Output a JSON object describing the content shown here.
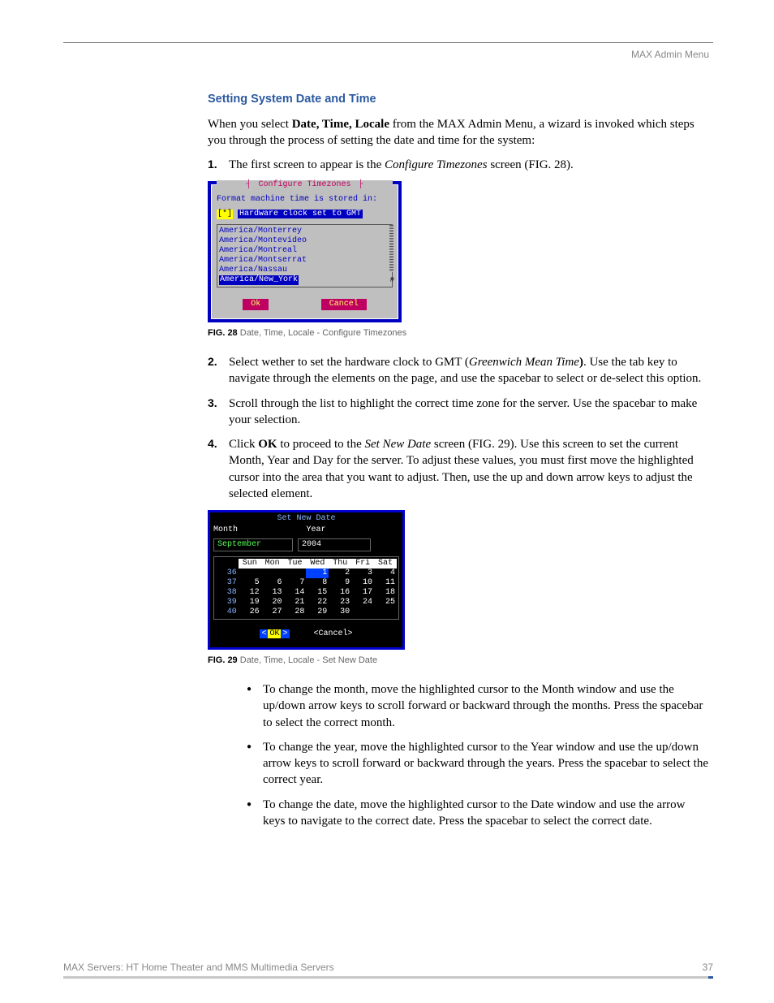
{
  "header": {
    "section": "MAX Admin Menu"
  },
  "title": "Setting System Date and Time",
  "intro": {
    "pre": "When you select ",
    "bold": "Date, Time, Locale",
    "post": " from the MAX Admin Menu, a wizard is invoked which steps you through the process of setting the date and time for the system:"
  },
  "steps": {
    "s1": {
      "num": "1.",
      "pre": "The first screen to appear is the ",
      "ital": "Configure Timezones",
      "post": " screen (FIG. 28)."
    },
    "s2": {
      "num": "2.",
      "pre": "Select wether to set the hardware clock to GMT (",
      "ital": "Greenwich Mean Time",
      "mid": "",
      "bold": ")",
      "post": ". Use the tab key to navigate through the elements on the page, and use the spacebar to select or de-select this option."
    },
    "s3": {
      "num": "3.",
      "text": "Scroll through the list to highlight the correct time zone for the server. Use the spacebar to make your selection."
    },
    "s4": {
      "num": "4.",
      "pre": "Click ",
      "bold": "OK",
      "mid": " to proceed to the ",
      "ital": "Set New Date",
      "post": " screen (FIG. 29). Use this screen to set the current Month, Year and Day for the server. To adjust these values, you must first move the highlighted cursor into the area that you want to adjust. Then, use the up and down arrow keys to adjust the selected element."
    }
  },
  "fig28": {
    "title": "Configure Timezones",
    "prompt": "Format machine time is stored in:",
    "checkbox_mark": "[*]",
    "checkbox_label": "Hardware clock set to GMT",
    "tz": {
      "a": "America/Monterrey",
      "b": "America/Montevideo",
      "c": "America/Montreal",
      "d": "America/Montserrat",
      "e": "America/Nassau",
      "f": "America/New_York"
    },
    "ok": "Ok",
    "cancel": "Cancel",
    "caption_tag": "FIG. 28",
    "caption": "  Date, Time, Locale - Configure Timezones"
  },
  "fig29": {
    "title": "Set New Date",
    "month_label": "Month",
    "year_label": "Year",
    "month_value": "September",
    "year_value": "2004",
    "days": {
      "d0": "Sun",
      "d1": "Mon",
      "d2": "Tue",
      "d3": "Wed",
      "d4": "Thu",
      "d5": "Fri",
      "d6": "Sat"
    },
    "weeks": {
      "w36": "36",
      "w37": "37",
      "w38": "38",
      "w39": "39",
      "w40": "40"
    },
    "ok_pre": "<",
    "ok": "OK",
    "ok_post": ">",
    "cancel": "<Cancel>",
    "caption_tag": "FIG. 29",
    "caption": "  Date, Time, Locale - Set New Date"
  },
  "chart_data": {
    "type": "table",
    "title": "Set New Date calendar — September 2004",
    "columns": [
      "Week",
      "Sun",
      "Mon",
      "Tue",
      "Wed",
      "Thu",
      "Fri",
      "Sat"
    ],
    "rows": [
      [
        "36",
        "",
        "",
        "",
        "1",
        "2",
        "3",
        "4"
      ],
      [
        "37",
        "5",
        "6",
        "7",
        "8",
        "9",
        "10",
        "11"
      ],
      [
        "38",
        "12",
        "13",
        "14",
        "15",
        "16",
        "17",
        "18"
      ],
      [
        "39",
        "19",
        "20",
        "21",
        "22",
        "23",
        "24",
        "25"
      ],
      [
        "40",
        "26",
        "27",
        "28",
        "29",
        "30",
        "",
        ""
      ]
    ],
    "selected": {
      "row": 0,
      "col": 4,
      "value": "1"
    }
  },
  "bullets": {
    "b1": "To change the month, move the highlighted cursor to the Month window and use the up/down arrow keys to scroll forward or backward through the months. Press the spacebar to select the correct month.",
    "b2": "To change the year, move the highlighted cursor to the Year window and use the up/down arrow keys to scroll forward or backward through the years. Press the spacebar to select the correct year.",
    "b3": "To change the date, move the highlighted cursor to the Date window and use the arrow keys to navigate to the correct date. Press the spacebar to select the correct date."
  },
  "footer": {
    "left": "MAX Servers: HT Home Theater and MMS Multimedia Servers",
    "right": "37"
  }
}
